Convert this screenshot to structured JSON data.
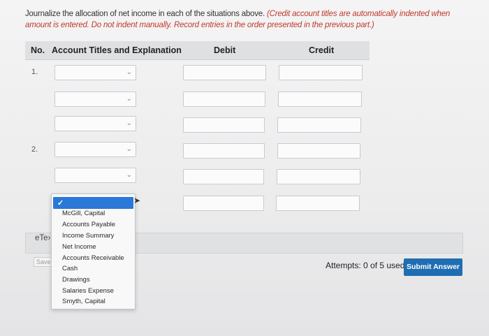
{
  "instructions": {
    "plain": "Journalize the allocation of net income in each of the situations above. ",
    "note": "(Credit account titles are automatically indented when amount is entered. Do not indent manually. Record entries in the order presented in the previous part.)"
  },
  "table": {
    "col_no": "No.",
    "col_account": "Account Titles and Explanation",
    "col_debit": "Debit",
    "col_credit": "Credit"
  },
  "entries": [
    {
      "number": "1."
    },
    {
      "number": "2."
    }
  ],
  "dropdown": {
    "options": [
      "McGill, Capital",
      "Accounts Payable",
      "Income Summary",
      "Net Income",
      "Accounts Receivable",
      "Cash",
      "Drawings",
      "Salaries Expense",
      "Smyth, Capital"
    ],
    "check_icon": "✓"
  },
  "footer": {
    "etext_label": "eTe›",
    "save_label": "Save f",
    "attempts_text": "Attempts: 0 of 5 used",
    "submit_label": "Submit Answer"
  },
  "colors": {
    "submit_bg": "#1f6eb3",
    "selected_option_bg": "#2a78d8",
    "note_red": "#c0392b"
  }
}
